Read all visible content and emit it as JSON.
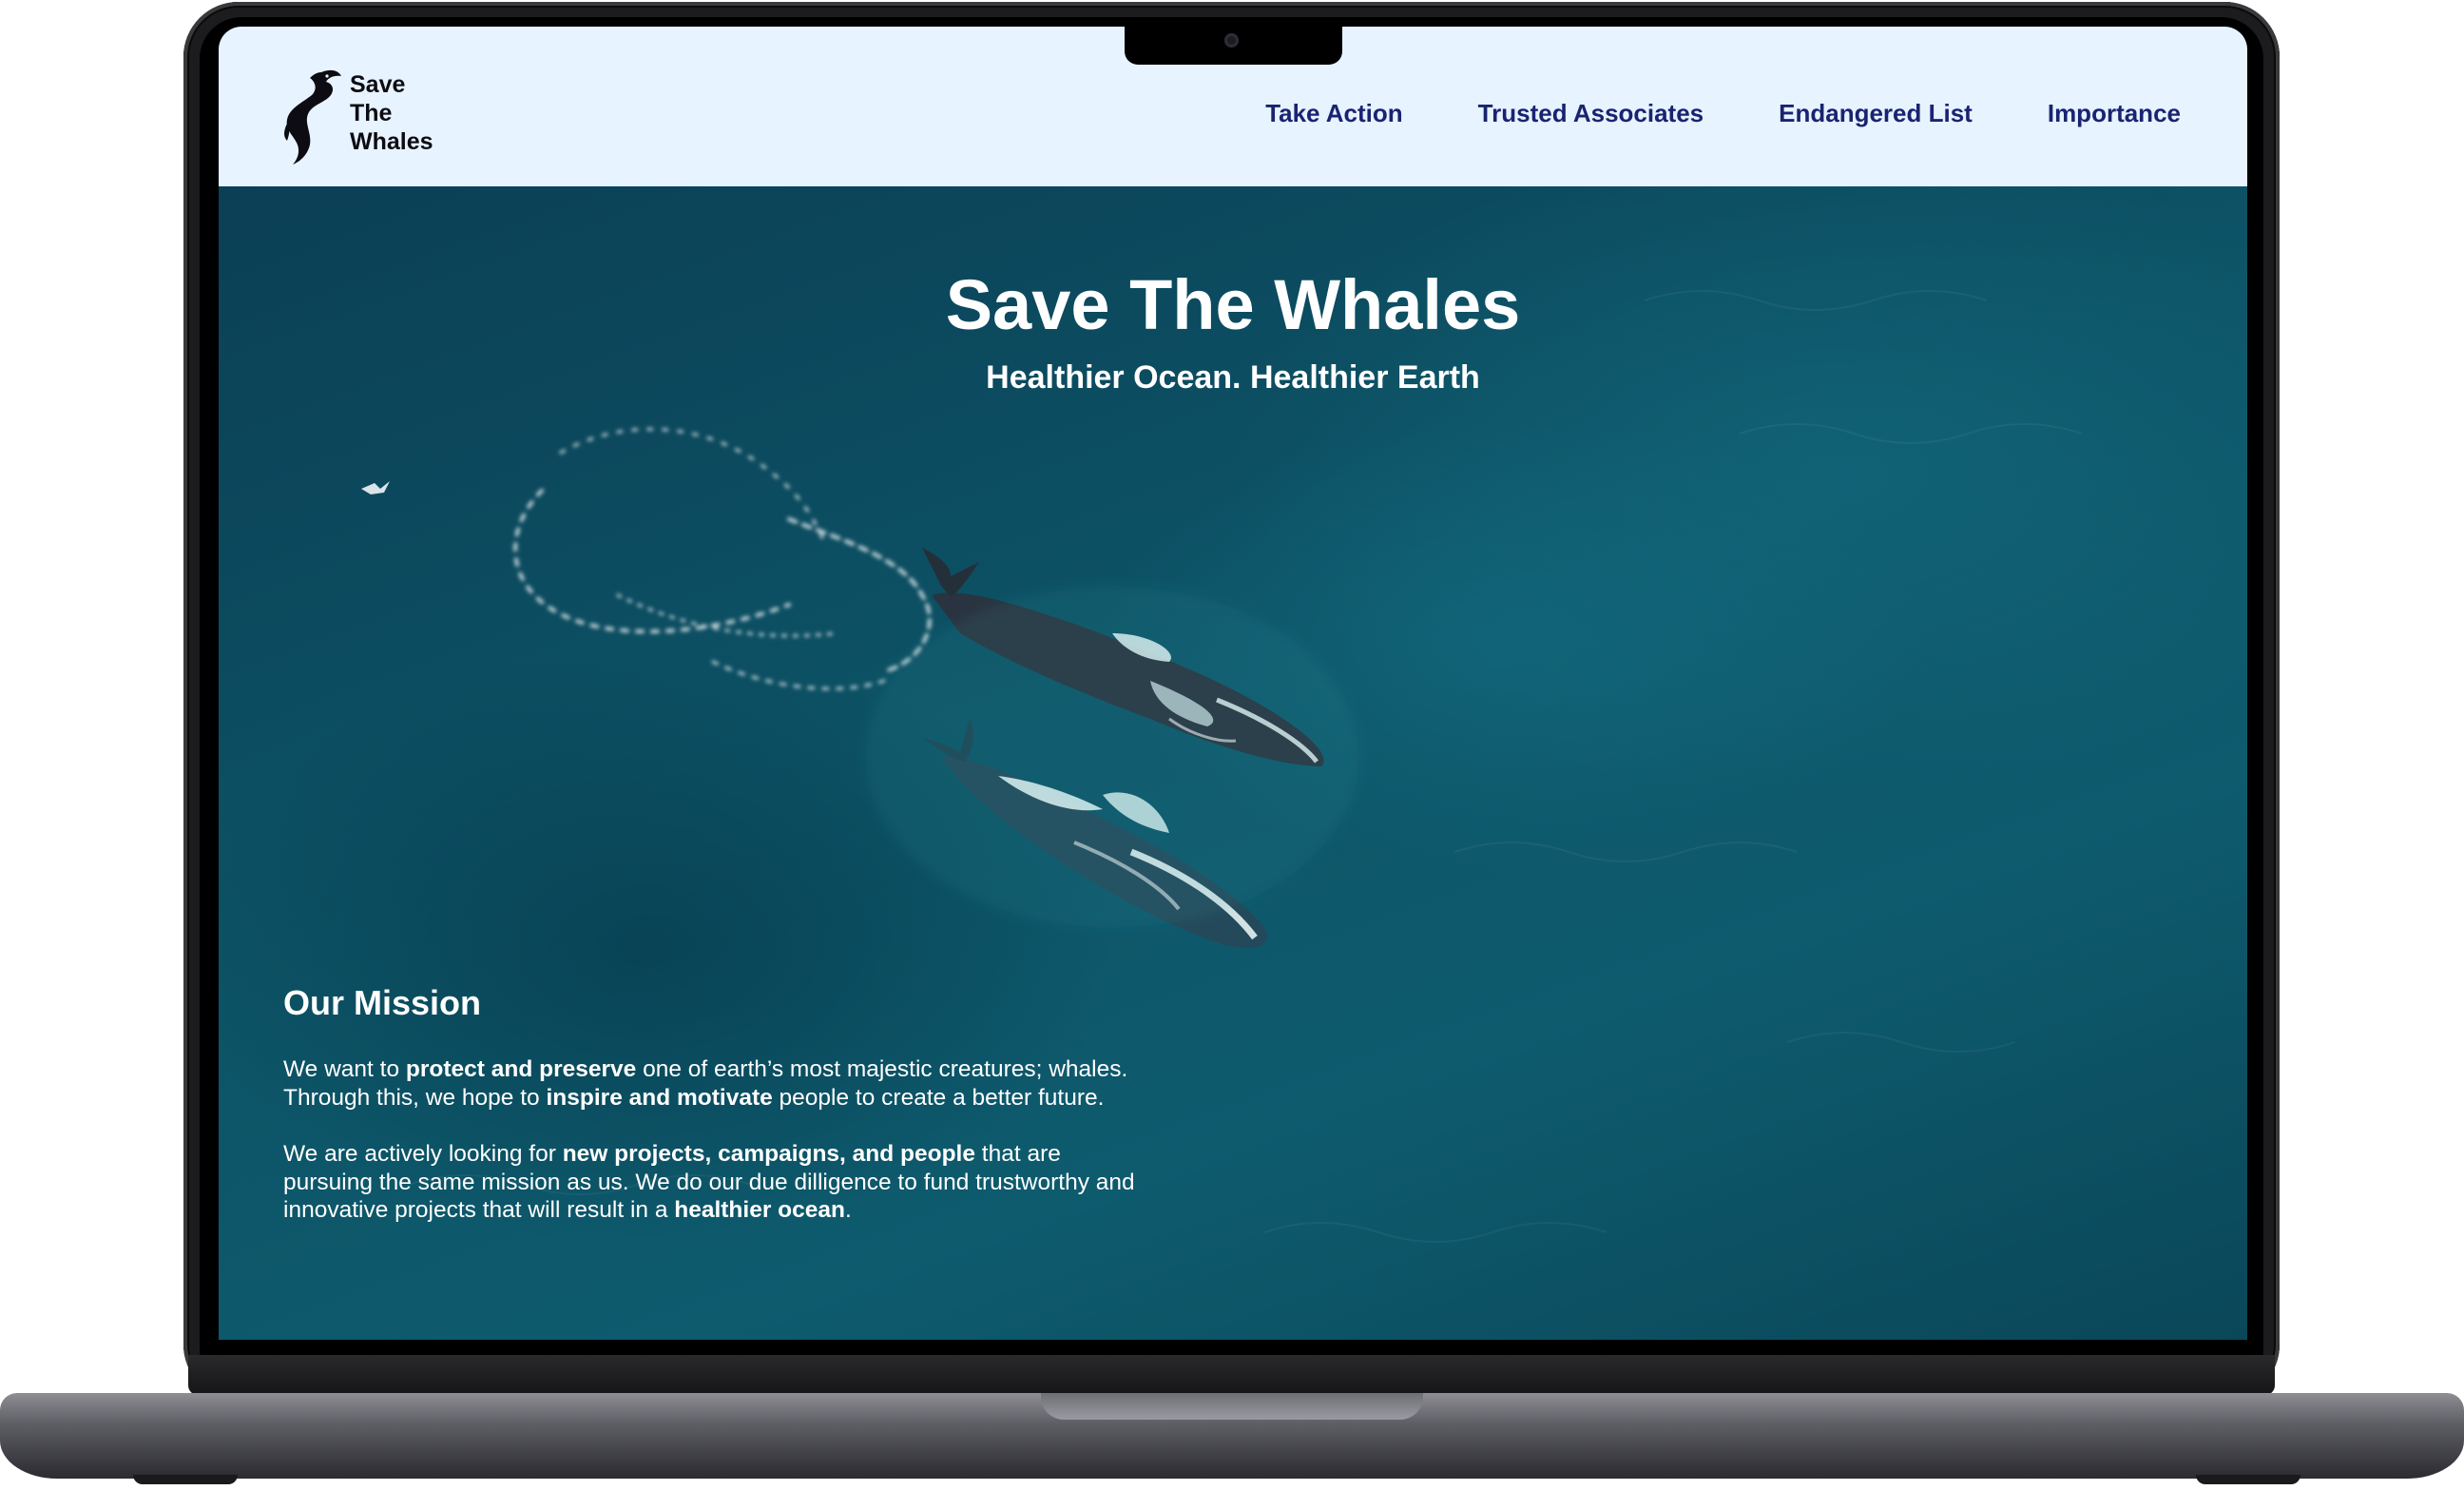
{
  "site": {
    "logo_lines": [
      "Save",
      "The",
      "Whales"
    ]
  },
  "nav": {
    "items": [
      {
        "label": "Take Action"
      },
      {
        "label": "Trusted Associates"
      },
      {
        "label": "Endangered List"
      },
      {
        "label": "Importance"
      }
    ]
  },
  "hero": {
    "title": "Save The Whales",
    "subtitle": "Healthier Ocean. Healthier Earth"
  },
  "mission": {
    "heading": "Our Mission",
    "p1": {
      "t1": "We want to ",
      "b1": "protect and preserve",
      "t2": " one of earth’s most majestic creatures; whales. Through this, we hope to ",
      "b2": "inspire and motivate",
      "t3": " people to create a better future."
    },
    "p2": {
      "t1": "We are actively looking for ",
      "b1": "new projects, campaigns, and people",
      "t2": " that are pursuing the same mission as us. We do our due dilligence to fund trustworthy and innovative projects that will result in a ",
      "b2": "healthier ocean",
      "t3": "."
    }
  },
  "icons": {
    "logo": "whale-tail-icon",
    "camera": "camera-icon"
  },
  "colors": {
    "navbar_bg": "#e7f3fe",
    "nav_link": "#1a2371",
    "ocean": "#0d5467",
    "text_on_hero": "#ffffff"
  }
}
